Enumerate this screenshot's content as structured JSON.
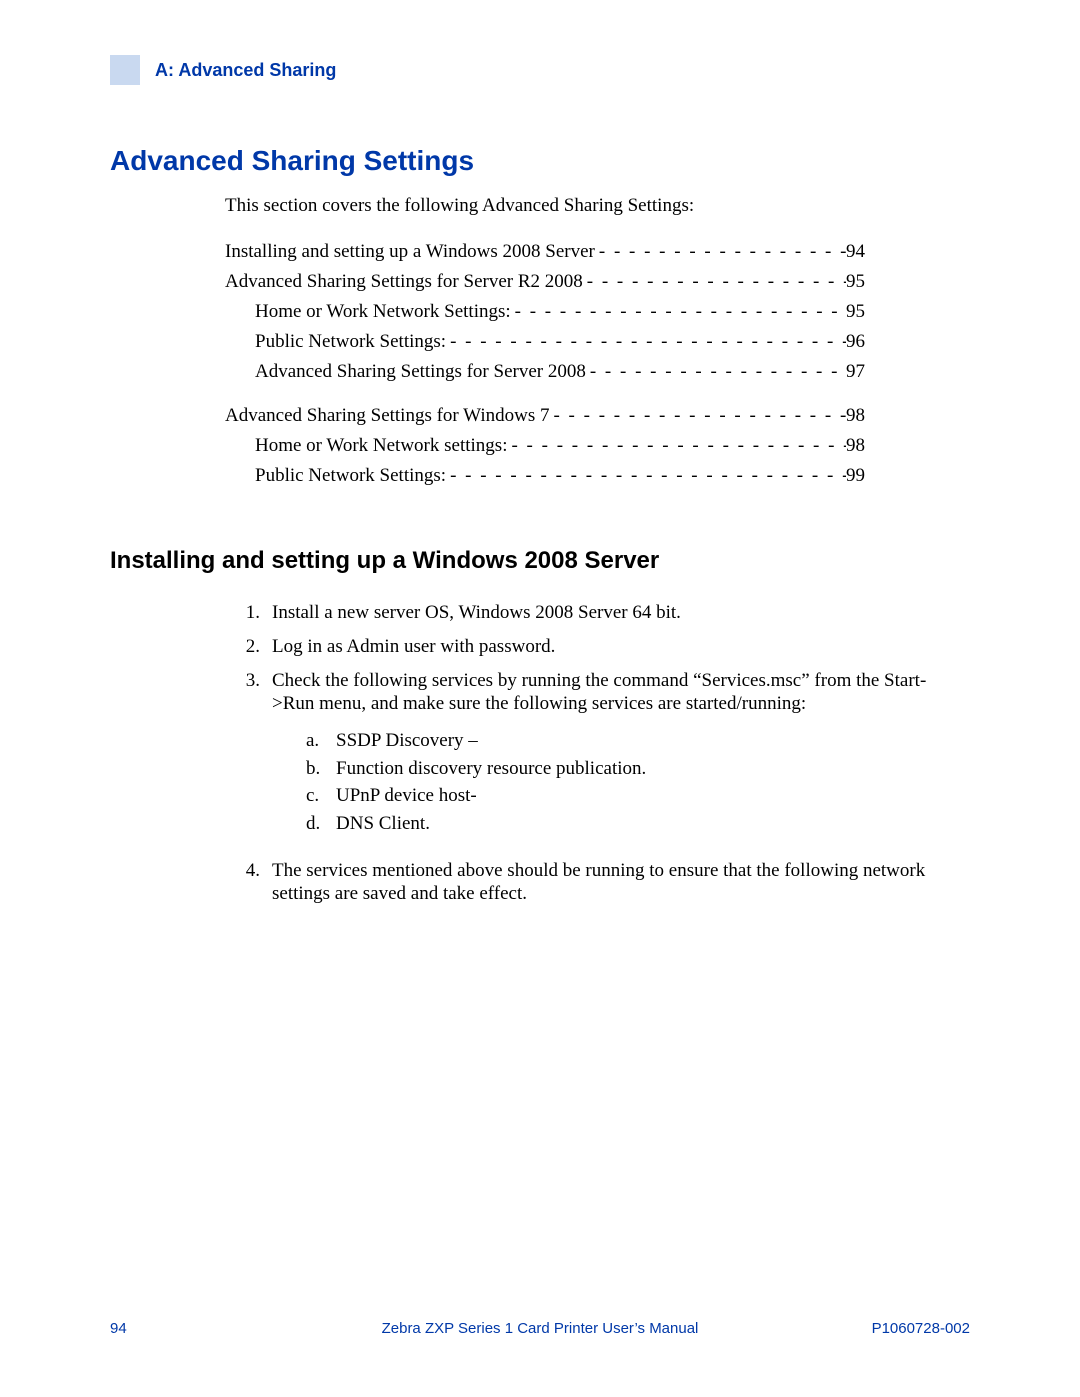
{
  "header": {
    "section_label": "A: Advanced Sharing"
  },
  "title": "Advanced Sharing Settings",
  "intro": "This section covers the following Advanced Sharing Settings:",
  "toc": [
    {
      "label": "Installing and setting up a Windows 2008 Server",
      "page": "94",
      "indent": 0
    },
    {
      "label": "Advanced Sharing Settings for Server R2 2008",
      "page": "95",
      "indent": 0
    },
    {
      "label": "Home or Work Network Settings:",
      "page": "95",
      "indent": 1
    },
    {
      "label": "Public Network Settings:",
      "page": "96",
      "indent": 1
    },
    {
      "label": "Advanced Sharing Settings for Server 2008 ",
      "page": "97",
      "indent": 1
    },
    {
      "gap": true
    },
    {
      "label": "Advanced Sharing Settings for Windows 7",
      "page": "98",
      "indent": 0
    },
    {
      "label": "Home or Work Network settings:",
      "page": "98",
      "indent": 1
    },
    {
      "label": "Public Network Settings:",
      "page": "99",
      "indent": 1
    }
  ],
  "subheading": "Installing and setting up a Windows 2008 Server",
  "steps": [
    {
      "n": "1.",
      "text": "Install a new server OS, Windows 2008 Server 64 bit."
    },
    {
      "n": "2.",
      "text": "Log in as Admin user with password."
    },
    {
      "n": "3.",
      "text": "Check the following services by running the command “Services.msc” from the Start->Run menu, and make sure the following services are started/running:",
      "sub": [
        {
          "l": "a.",
          "t": "SSDP Discovery –"
        },
        {
          "l": "b.",
          "t": "Function discovery resource publication."
        },
        {
          "l": "c.",
          "t": "UPnP device host-"
        },
        {
          "l": "d.",
          "t": "DNS Client."
        }
      ]
    },
    {
      "n": "4.",
      "text": "The services mentioned above should be running to ensure that the following network settings are saved and take effect."
    }
  ],
  "footer": {
    "page_number": "94",
    "manual_title": "Zebra ZXP Series 1 Card Printer User’s Manual",
    "doc_number": "P1060728-002"
  }
}
